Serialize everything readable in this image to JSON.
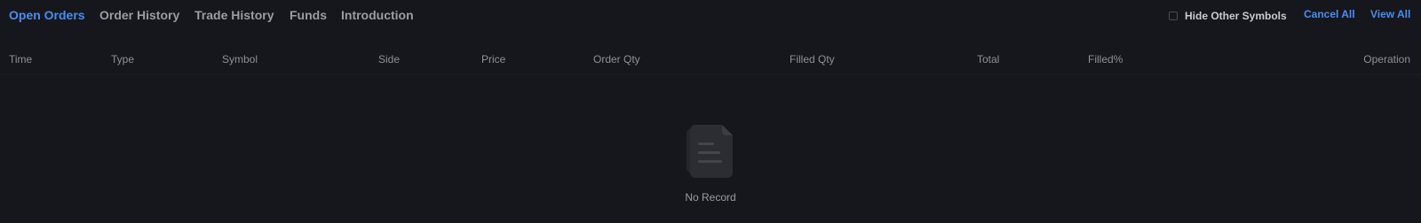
{
  "tabs": {
    "open_orders": "Open Orders",
    "order_history": "Order History",
    "trade_history": "Trade History",
    "funds": "Funds",
    "introduction": "Introduction"
  },
  "controls": {
    "hide_other_symbols": "Hide Other Symbols",
    "hide_other_symbols_checked": false,
    "cancel_all": "Cancel All",
    "view_all": "View All"
  },
  "table": {
    "columns": {
      "time": "Time",
      "type": "Type",
      "symbol": "Symbol",
      "side": "Side",
      "price": "Price",
      "order_qty": "Order Qty",
      "filled_qty": "Filled Qty",
      "total": "Total",
      "filled_pct": "Filled%",
      "operation": "Operation"
    },
    "rows": []
  },
  "empty_state": {
    "icon": "document-icon",
    "text": "No Record"
  },
  "colors": {
    "background": "#16171d",
    "accent": "#4a8df0",
    "tab_inactive": "#9a9ca3",
    "header_text": "#8e9097"
  }
}
